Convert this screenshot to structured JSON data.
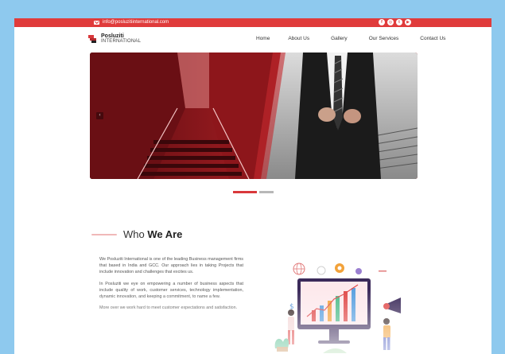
{
  "topbar": {
    "email": "info@posluzitiinternational.com",
    "socials": [
      {
        "icon": "facebook-icon",
        "glyph": "f"
      },
      {
        "icon": "instagram-icon",
        "glyph": "◎"
      },
      {
        "icon": "twitter-icon",
        "glyph": "t"
      },
      {
        "icon": "youtube-icon",
        "glyph": "▶"
      }
    ],
    "color": "#e03b3b"
  },
  "brand": {
    "name_line1": "Posluziti",
    "name_line2": "INTERNATIONAL"
  },
  "nav": {
    "items": [
      "Home",
      "About Us",
      "Gallery",
      "Our Services",
      "Contact Us"
    ]
  },
  "slider": {
    "prev_glyph": "‹",
    "active_index": 0,
    "slide_count": 2
  },
  "about": {
    "title_light": "Who ",
    "title_bold": "We Are",
    "paragraphs": [
      "We Posluziti International is one of the leading Business management firms that based in India and GCC. Our approach lies in taking Projects that include innovation and challenges that excites us.",
      "In Posluziti we eye on empowering a number of business aspects that include quality of work, customer services, technology implementation, dynamic innovation, and keeping a commitment, to name a few.",
      "More over we work hard to meet customer expectations and satisfaction."
    ]
  },
  "colors": {
    "accent": "#d9383b",
    "page_background": "#8ec9ee"
  }
}
